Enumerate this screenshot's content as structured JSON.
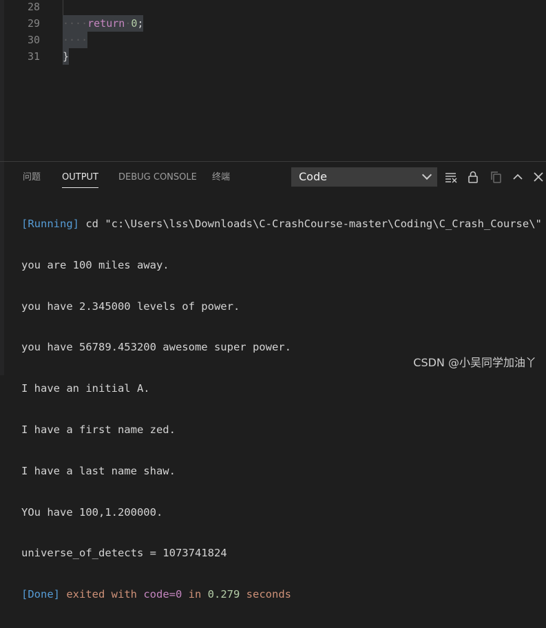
{
  "editor": {
    "lines": [
      {
        "number": "28",
        "indent": "",
        "keyword": "",
        "value": "",
        "punct": ""
      },
      {
        "number": "29",
        "indent": "····",
        "keyword": "return",
        "value": "0",
        "punct": ";"
      },
      {
        "number": "30",
        "indent": "····",
        "keyword": "",
        "value": "",
        "punct": ""
      },
      {
        "number": "31",
        "indent": "",
        "keyword": "",
        "value": "",
        "punct": "}"
      }
    ]
  },
  "panel": {
    "tabs": [
      "问题",
      "OUTPUT",
      "DEBUG CONSOLE",
      "终端"
    ],
    "active_tab": "OUTPUT",
    "output_channel": "Code",
    "icons": [
      "clear-output-icon",
      "lock-scroll-icon",
      "copy-icon",
      "maximize-panel-icon",
      "close-panel-icon"
    ]
  },
  "output": {
    "running_tag": "[Running]",
    "running_cmd": " cd \"c:\\Users\\lss\\Downloads\\C-CrashCourse-master\\Coding\\C_Crash_Course\\\"",
    "lines": [
      "you are 100 miles away.",
      "you have 2.345000 levels of power.",
      "you have 56789.453200 awesome super power.",
      "I have an initial A.",
      "I have a first name zed.",
      "I have a last name shaw.",
      "YOu have 100,1.200000.",
      "universe_of_detects = 1073741824"
    ],
    "done_tag": "[Done]",
    "done_pre": " exited with ",
    "done_code": "code=0",
    "done_in": " in ",
    "done_time": "0.279",
    "done_post": " seconds"
  },
  "watermark": "CSDN @小吴同学加油丫",
  "colors": {
    "background": "#1e1e1e",
    "keyword": "#c586c0",
    "number": "#b5cea8",
    "running_tag": "#569cd6",
    "done_text": "#ce9178"
  }
}
